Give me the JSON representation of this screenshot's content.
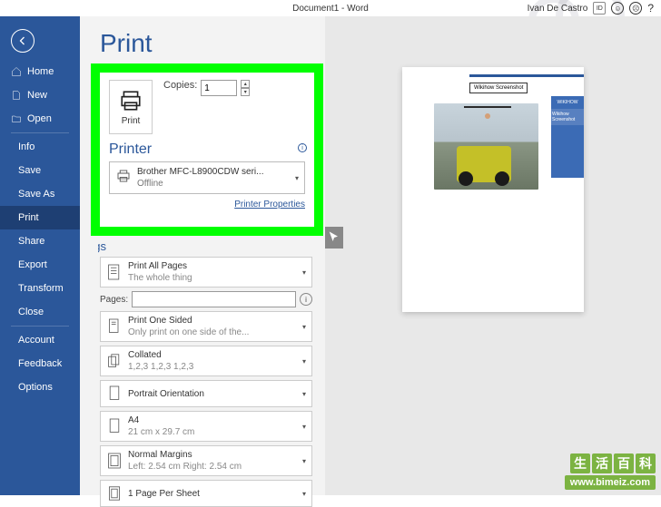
{
  "app": {
    "title": "Document1 - Word",
    "user": "Ivan De Castro"
  },
  "sidebar": {
    "items": [
      {
        "label": "Home"
      },
      {
        "label": "New"
      },
      {
        "label": "Open"
      }
    ],
    "sub": [
      {
        "label": "Info"
      },
      {
        "label": "Save"
      },
      {
        "label": "Save As"
      },
      {
        "label": "Print"
      },
      {
        "label": "Share"
      },
      {
        "label": "Export"
      },
      {
        "label": "Transform"
      },
      {
        "label": "Close"
      }
    ],
    "footer": [
      {
        "label": "Account"
      },
      {
        "label": "Feedback"
      },
      {
        "label": "Options"
      }
    ]
  },
  "print": {
    "title": "Print",
    "button_label": "Print",
    "copies_label": "Copies:",
    "copies_value": "1",
    "printer_heading": "Printer",
    "printer_name": "Brother MFC-L8900CDW seri...",
    "printer_status": "Offline",
    "printer_props": "Printer Properties"
  },
  "settings": {
    "heading_partial": "Settings",
    "rows": [
      {
        "title": "Print All Pages",
        "sub": "The whole thing"
      },
      {
        "title": "Print One Sided",
        "sub": "Only print on one side of the..."
      },
      {
        "title": "Collated",
        "sub": "1,2,3   1,2,3   1,2,3"
      },
      {
        "title": "Portrait Orientation",
        "sub": ""
      },
      {
        "title": "A4",
        "sub": "21 cm x 29.7 cm"
      },
      {
        "title": "Normal Margins",
        "sub": "Left: 2.54 cm  Right: 2.54 cm"
      },
      {
        "title": "1 Page Per Sheet",
        "sub": ""
      }
    ],
    "pages_label": "Pages:"
  },
  "preview": {
    "header_label": "Wikihow Screenshot",
    "wikihow": "WIKIHOW",
    "wikihow_sub": "Wikihow Screenshot"
  },
  "watermark": {
    "chars": [
      "生",
      "活",
      "百",
      "科"
    ],
    "url": "www.bimeiz.com"
  }
}
